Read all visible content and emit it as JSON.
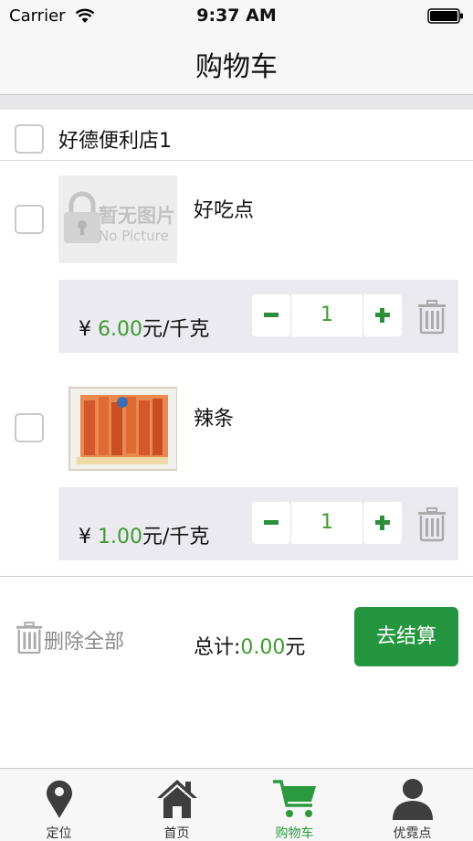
{
  "status_bar": {
    "carrier": "Carrier",
    "time": "9:37 AM"
  },
  "nav": {
    "title": "购物车"
  },
  "cart": {
    "shop_name": "好德便利店1",
    "items": [
      {
        "name": "好吃点",
        "image_text_1": "暂无图片",
        "image_text_2": "No Picture",
        "currency": "¥",
        "price": "6.00",
        "unit": "元/千克",
        "quantity": "1"
      },
      {
        "name": "辣条",
        "currency": "¥",
        "price": "1.00",
        "unit": "元/千克",
        "quantity": "1"
      }
    ]
  },
  "footer": {
    "delete_all": "删除全部",
    "total_label": "总计:",
    "total_value": "0.00",
    "total_unit": "元",
    "checkout": "去结算"
  },
  "tab_bar": {
    "tabs": [
      {
        "label": "定位",
        "icon": "location-pin-icon"
      },
      {
        "label": "首页",
        "icon": "home-icon"
      },
      {
        "label": "购物车",
        "icon": "cart-icon",
        "active": true
      },
      {
        "label": "优霓点",
        "icon": "person-icon"
      }
    ]
  },
  "colors": {
    "accent_green": "#23963f",
    "price_green": "#3f9b2f",
    "panel_gray": "#ebeaf0"
  }
}
